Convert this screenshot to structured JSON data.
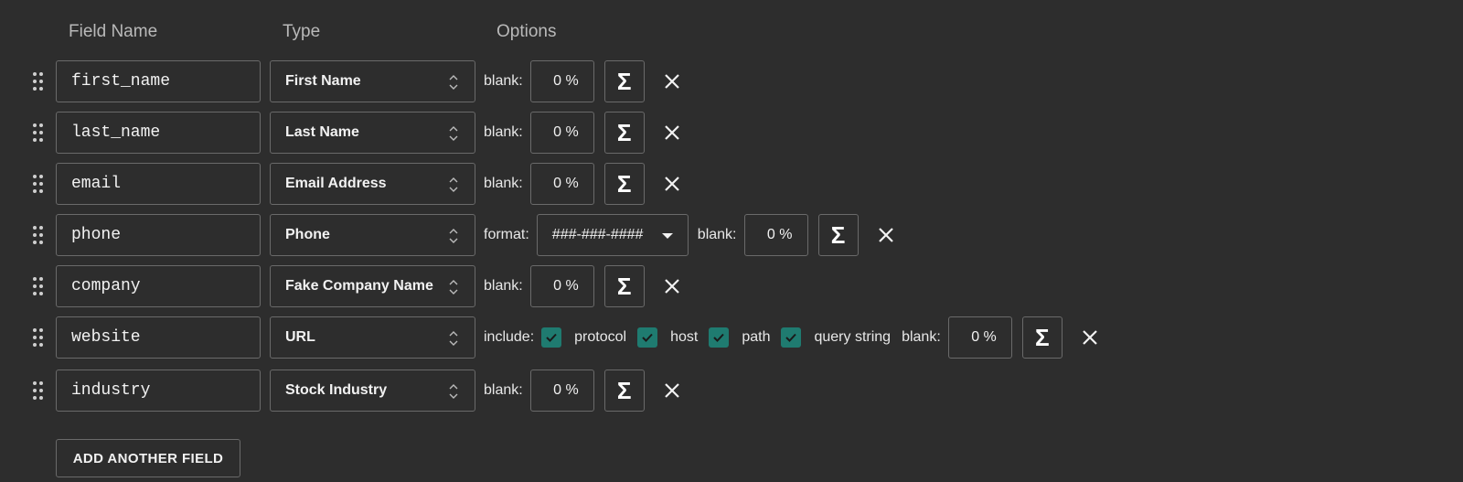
{
  "headers": {
    "field_name": "Field Name",
    "type": "Type",
    "options": "Options"
  },
  "icons": {
    "drag": "drag-handle-icon",
    "sort": "up-down-arrows-icon",
    "sigma": "sigma-icon",
    "remove": "close-icon",
    "check": "checkmark-icon"
  },
  "colors": {
    "background": "#2d2d2d",
    "border": "#6a6a6a",
    "checkbox": "#1f7b70"
  },
  "rows": [
    {
      "name": "first_name",
      "type": "First Name",
      "blank_label": "blank:",
      "blank": "0 %",
      "sigma": "Σ"
    },
    {
      "name": "last_name",
      "type": "Last Name",
      "blank_label": "blank:",
      "blank": "0 %",
      "sigma": "Σ"
    },
    {
      "name": "email",
      "type": "Email Address",
      "blank_label": "blank:",
      "blank": "0 %",
      "sigma": "Σ"
    },
    {
      "name": "phone",
      "type": "Phone",
      "format_label": "format:",
      "format": "###-###-####",
      "blank_label": "blank:",
      "blank": "0 %",
      "sigma": "Σ"
    },
    {
      "name": "company",
      "type": "Fake Company Name",
      "blank_label": "blank:",
      "blank": "0 %",
      "sigma": "Σ"
    },
    {
      "name": "website",
      "type": "URL",
      "include_label": "include:",
      "include": [
        {
          "label": "protocol",
          "checked": true
        },
        {
          "label": "host",
          "checked": true
        },
        {
          "label": "path",
          "checked": true
        },
        {
          "label": "query string",
          "checked": true
        }
      ],
      "blank_label": "blank:",
      "blank": "0 %",
      "sigma": "Σ"
    },
    {
      "name": "industry",
      "type": "Stock Industry",
      "blank_label": "blank:",
      "blank": "0 %",
      "sigma": "Σ"
    }
  ],
  "add_button": "ADD ANOTHER FIELD"
}
